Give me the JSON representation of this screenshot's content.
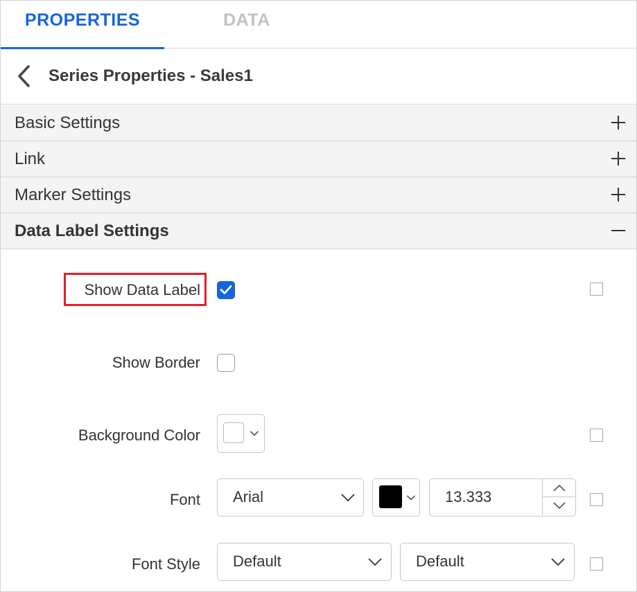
{
  "tabs": [
    {
      "label": "PROPERTIES",
      "active": true
    },
    {
      "label": "DATA",
      "active": false
    }
  ],
  "header": {
    "title": "Series Properties - Sales1",
    "back_icon": "chevron-left-icon"
  },
  "sections": [
    {
      "label": "Basic Settings",
      "state": "collapsed"
    },
    {
      "label": "Link",
      "state": "collapsed"
    },
    {
      "label": "Marker Settings",
      "state": "collapsed"
    },
    {
      "label": "Data Label Settings",
      "state": "expanded"
    }
  ],
  "data_label": {
    "show_data_label": {
      "label": "Show Data Label",
      "checked": true
    },
    "show_border": {
      "label": "Show Border",
      "checked": false
    },
    "background_color": {
      "label": "Background Color",
      "color": "#ffffff"
    },
    "font": {
      "label": "Font",
      "family": "Arial",
      "color": "#000000",
      "size": "13.333"
    },
    "font_style": {
      "label": "Font Style",
      "style": "Default",
      "weight": "Default"
    }
  },
  "colors": {
    "accent": "#1565e0",
    "highlight": "#e0202a",
    "inactive_tab": "#c2c2c2"
  }
}
